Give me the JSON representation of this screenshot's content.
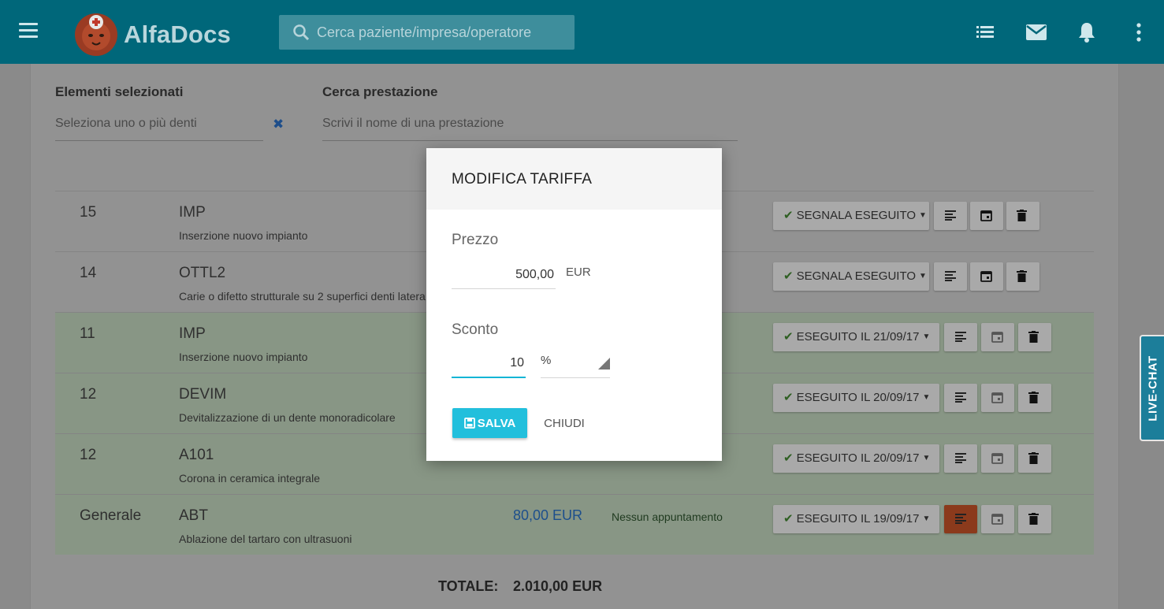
{
  "header": {
    "brand": "AlfaDocs",
    "search_placeholder": "Cerca paziente/impresa/operatore",
    "icons": [
      "menu-icon",
      "list-icon",
      "mail-icon",
      "bell-icon",
      "more-vert-icon"
    ]
  },
  "selection": {
    "label": "Elementi selezionati",
    "placeholder": "Seleziona uno o più denti"
  },
  "search_service": {
    "label": "Cerca prestazione",
    "placeholder": "Scrivi il nome di una prestazione"
  },
  "rows": [
    {
      "tooth": "15",
      "code": "IMP",
      "desc": "Inserzione nuovo impianto",
      "price": "",
      "appointment": "",
      "status": "SEGNALA ESEGUITO",
      "done": false
    },
    {
      "tooth": "14",
      "code": "OTTL2",
      "desc": "Carie o difetto strutturale su 2 superfici denti latera",
      "price": "",
      "appointment": "",
      "status": "SEGNALA ESEGUITO",
      "done": false
    },
    {
      "tooth": "11",
      "code": "IMP",
      "desc": "Inserzione nuovo impianto",
      "price": "",
      "appointment": "",
      "status": "ESEGUITO IL 21/09/17",
      "done": true
    },
    {
      "tooth": "12",
      "code": "DEVIM",
      "desc": "Devitalizzazione di un dente monoradicolare",
      "price": "",
      "appointment": "",
      "status": "ESEGUITO IL 20/09/17",
      "done": true
    },
    {
      "tooth": "12",
      "code": "A101",
      "desc": "Corona in ceramica integrale",
      "price": "",
      "appointment": "",
      "status": "ESEGUITO IL 20/09/17",
      "done": true
    },
    {
      "tooth": "Generale",
      "code": "ABT",
      "desc": "Ablazione del tartaro con ultrasuoni",
      "price": "80,00 EUR",
      "appointment": "Nessun appuntamento",
      "status": "ESEGUITO IL 19/09/17",
      "done": true
    }
  ],
  "total": {
    "label": "TOTALE:",
    "value": "2.010,00 EUR"
  },
  "livechat": "LIVE-CHAT",
  "modal": {
    "title": "MODIFICA TARIFFA",
    "price_label": "Prezzo",
    "price_value": "500,00",
    "price_unit": "EUR",
    "discount_label": "Sconto",
    "discount_value": "10",
    "discount_unit": "%",
    "save_label": "SALVA",
    "close_label": "CHIUDI"
  },
  "colors": {
    "topbar": "#00677a",
    "accent": "#22bfdc",
    "active_notes": "#8b3a1c",
    "done_row": "#889685"
  }
}
